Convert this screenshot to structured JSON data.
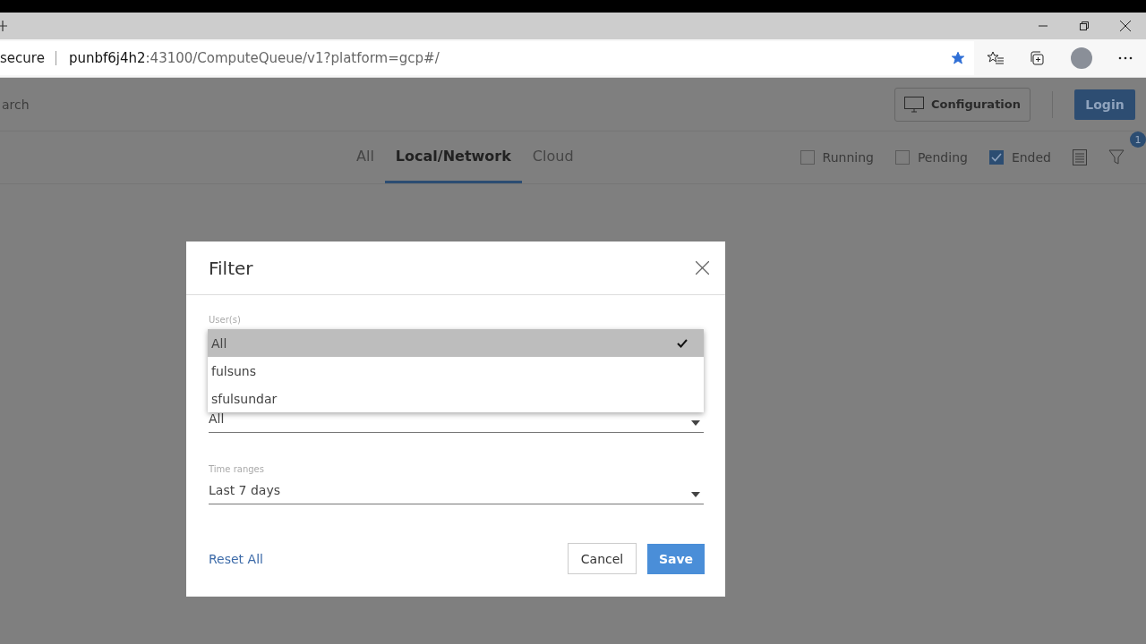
{
  "browser": {
    "address_prefix": "secure",
    "address_host": "punbf6j4h2",
    "address_path": ":43100/ComputeQueue/v1?platform=gcp#/",
    "favorited": true
  },
  "header": {
    "search_placeholder": "arch",
    "configuration_button": "Configuration",
    "login_button": "Login"
  },
  "tabs": [
    {
      "label": "All",
      "selected": false
    },
    {
      "label": "Local/Network",
      "selected": true
    },
    {
      "label": "Cloud",
      "selected": false
    }
  ],
  "status_filters": [
    {
      "label": "Running",
      "checked": false
    },
    {
      "label": "Pending",
      "checked": false
    },
    {
      "label": "Ended",
      "checked": true
    }
  ],
  "filter_badge": "1",
  "dialog": {
    "title": "Filter",
    "fields": [
      {
        "label": "User(s)"
      },
      {
        "value": "All"
      },
      {
        "label": "Time ranges",
        "value": "Last 7 days"
      }
    ],
    "dropdown_options": [
      {
        "label": "All",
        "selected": true
      },
      {
        "label": "fulsuns",
        "selected": false
      },
      {
        "label": "sfulsundar",
        "selected": false
      }
    ],
    "reset_link": "Reset All",
    "cancel_button": "Cancel",
    "save_button": "Save"
  }
}
